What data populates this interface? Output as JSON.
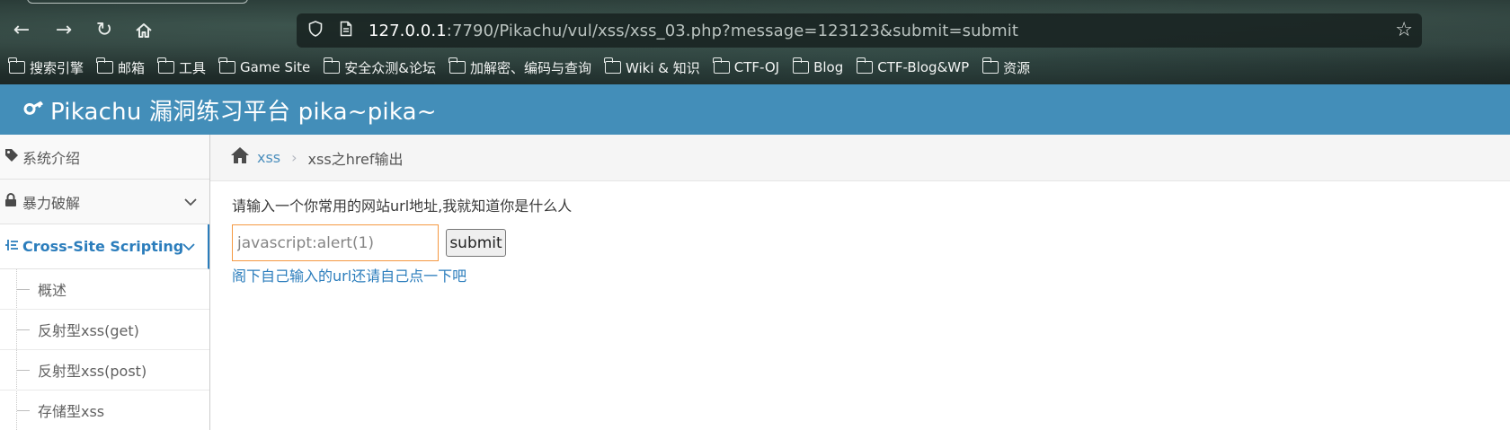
{
  "browser": {
    "url_host": "127.0.0.1",
    "url_rest": ":7790/Pikachu/vul/xss/xss_03.php?message=123123&submit=submit",
    "bookmarks": [
      {
        "label": "搜索引擎"
      },
      {
        "label": "邮箱"
      },
      {
        "label": "工具"
      },
      {
        "label": "Game Site"
      },
      {
        "label": "安全众测&论坛"
      },
      {
        "label": "加解密、编码与查询"
      },
      {
        "label": "Wiki & 知识"
      },
      {
        "label": "CTF-OJ"
      },
      {
        "label": "Blog"
      },
      {
        "label": "CTF-Blog&WP"
      },
      {
        "label": "资源"
      }
    ]
  },
  "header": {
    "title": "Pikachu 漏洞练习平台 pika~pika~"
  },
  "sidebar": {
    "items": [
      {
        "label": "系统介绍"
      },
      {
        "label": "暴力破解"
      },
      {
        "label": "Cross-Site Scripting"
      }
    ],
    "submenu": [
      {
        "label": "概述"
      },
      {
        "label": "反射型xss(get)"
      },
      {
        "label": "反射型xss(post)"
      },
      {
        "label": "存储型xss"
      }
    ]
  },
  "breadcrumbs": {
    "parent": "xss",
    "sep": "›",
    "current": "xss之href输出"
  },
  "main": {
    "prompt": "请输入一个你常用的网站url地址,我就知道你是什么人",
    "input_value": "javascript:alert(1)",
    "submit_label": "submit",
    "result_link": "阁下自己输入的url还请自己点一下吧"
  },
  "colors": {
    "header_bg": "#438eb9",
    "accent": "#2b7dbc",
    "input_border": "#f59942"
  }
}
